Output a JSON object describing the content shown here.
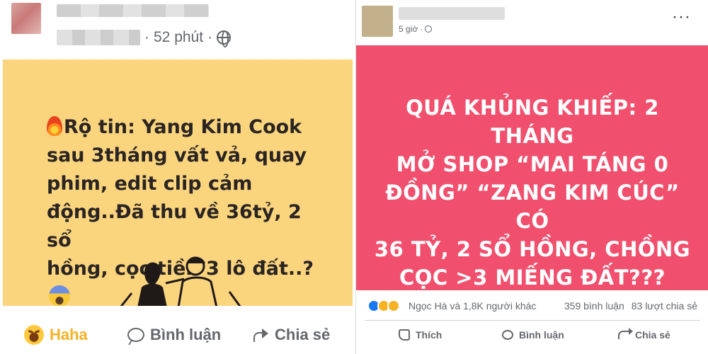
{
  "left_post": {
    "meta": {
      "time": "52 phút",
      "separator": "·",
      "privacy_icon": "globe-icon"
    },
    "card": {
      "background": "#fbd47e",
      "lines": [
        "Rộ tin: Yang Kim Cook",
        "sau 3tháng vất vả, quay",
        "phim, edit clip cảm",
        "động..Đã thu về 36tỷ, 2 sổ",
        "hồng, cọc tiền 3 lô đất..?"
      ],
      "leading_icon": "fire-icon",
      "trailing_icon": "face-screaming-icon"
    },
    "actions": {
      "haha_label": "Haha",
      "comment_label": "Bình luận",
      "share_label": "Chia sẻ"
    }
  },
  "right_post": {
    "meta": {
      "time": "5 giờ",
      "separator": "·",
      "privacy_icon": "globe-icon"
    },
    "more_label": "···",
    "card": {
      "background": "#f0506e",
      "lines": [
        "QUÁ KHỦNG KHIẾP: 2 THÁNG",
        "MỞ SHOP “MAI TÁNG 0",
        "ĐỒNG” “ZANG KIM CÚC” CÓ",
        "36 TỶ, 2 SỔ HỒNG, CHỒNG",
        "CỌC >3 MIẾNG ĐẤT???"
      ]
    },
    "stats": {
      "reactors": "Ngọc Hà và 1,8K người khác",
      "comments": "359 bình luận",
      "shares": "83 lượt chia sẻ"
    },
    "actions": {
      "like_label": "Thích",
      "comment_label": "Bình luận",
      "share_label": "Chia sẻ"
    }
  }
}
